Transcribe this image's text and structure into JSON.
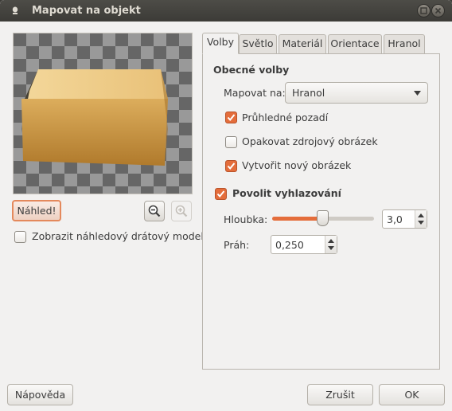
{
  "window": {
    "title": "Mapovat na objekt"
  },
  "preview": {
    "preview_button": "Náhled!",
    "wireframe_checkbox": {
      "label": "Zobrazit náhledový drátový model",
      "checked": false
    }
  },
  "tabs": [
    {
      "label": "Volby",
      "active": true
    },
    {
      "label": "Světlo",
      "active": false
    },
    {
      "label": "Materiál",
      "active": false
    },
    {
      "label": "Orientace",
      "active": false
    },
    {
      "label": "Hranol",
      "active": false
    }
  ],
  "options": {
    "general_header": "Obecné volby",
    "map_to_label": "Mapovat na:",
    "map_to_value": "Hranol",
    "transparent_background": {
      "label": "Průhledné pozadí",
      "checked": true
    },
    "tile_source": {
      "label": "Opakovat zdrojový obrázek",
      "checked": false
    },
    "create_new_image": {
      "label": "Vytvořit nový obrázek",
      "checked": true
    },
    "antialiasing": {
      "label": "Povolit vyhlazování",
      "checked": true
    },
    "depth_label": "Hloubka:",
    "depth_value": "3,0",
    "depth_slider_fraction": 0.5,
    "threshold_label": "Práh:",
    "threshold_value": "0,250"
  },
  "footer": {
    "help_button": "Nápověda",
    "cancel_button": "Zrušit",
    "ok_button": "OK"
  },
  "colors": {
    "accent": "#e46d3b",
    "titlebar": "#3c3b37",
    "dialog_bg": "#f2f1f0"
  },
  "icons": {
    "zoom_out": "zoom-out-icon",
    "zoom_in": "zoom-in-icon"
  }
}
